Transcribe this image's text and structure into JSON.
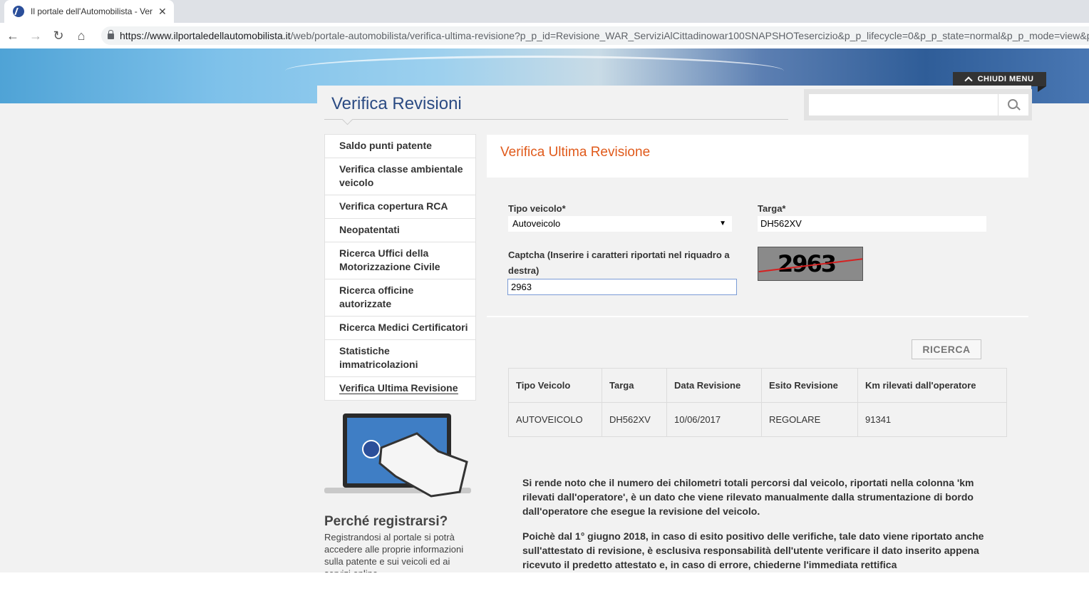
{
  "browser": {
    "tab_title": "Il portale dell'Automobilista - Ver",
    "close_glyph": "✕",
    "url_host": "https://www.ilportaledellautomobilista.it",
    "url_path": "/web/portale-automobilista/verifica-ultima-revisione?p_p_id=Revisione_WAR_ServiziAlCittadinowar100SNAPSHOTesercizio&p_p_lifecycle=0&p_p_state=normal&p_p_mode=view&p"
  },
  "header": {
    "chiudi_menu": "CHIUDI MENU",
    "page_title": "Verifica Revisioni"
  },
  "sidebar": {
    "items": [
      {
        "label": "Saldo punti patente"
      },
      {
        "label": "Verifica classe ambientale veicolo"
      },
      {
        "label": "Verifica copertura RCA"
      },
      {
        "label": "Neopatentati"
      },
      {
        "label": "Ricerca Uffici della Motorizzazione Civile"
      },
      {
        "label": "Ricerca officine autorizzate"
      },
      {
        "label": "Ricerca Medici Certificatori"
      },
      {
        "label": "Statistiche immatricolazioni"
      },
      {
        "label": "Verifica Ultima Revisione"
      }
    ],
    "why_title": "Perché registrarsi?",
    "why_text": "Registrandosi al portale si potrà accedere alle proprie informazioni sulla patente e sui  veicoli ed ai servizi online"
  },
  "form": {
    "heading": "Verifica Ultima Revisione",
    "tipo_label": "Tipo veicolo*",
    "tipo_value": "Autoveicolo",
    "targa_label": "Targa*",
    "targa_value": "DH562XV",
    "captcha_label": "Captcha (Inserire i caratteri riportati nel riquadro a destra)",
    "captcha_value": "2963",
    "captcha_image_text": "2963",
    "search_button": "RICERCA"
  },
  "results": {
    "headers": [
      "Tipo Veicolo",
      "Targa",
      "Data Revisione",
      "Esito Revisione",
      "Km rilevati dall'operatore"
    ],
    "row": [
      "AUTOVEICOLO",
      "DH562XV",
      "10/06/2017",
      "REGOLARE",
      "91341"
    ]
  },
  "notes": {
    "p1": "Si rende noto che il numero dei chilometri totali percorsi dal veicolo, riportati nella colonna 'km rilevati dall'operatore', è un dato che viene rilevato manualmente dalla strumentazione di bordo dall'operatore che esegue la revisione del veicolo.",
    "p2": "Poichè dal 1° giugno 2018, in caso di esito positivo delle verifiche, tale dato viene riportato anche sull'attestato di revisione, è esclusiva responsabilità dell'utente verificare il dato inserito appena ricevuto il predetto attestato e, in caso di errore, chiederne l'immediata rettifica"
  }
}
